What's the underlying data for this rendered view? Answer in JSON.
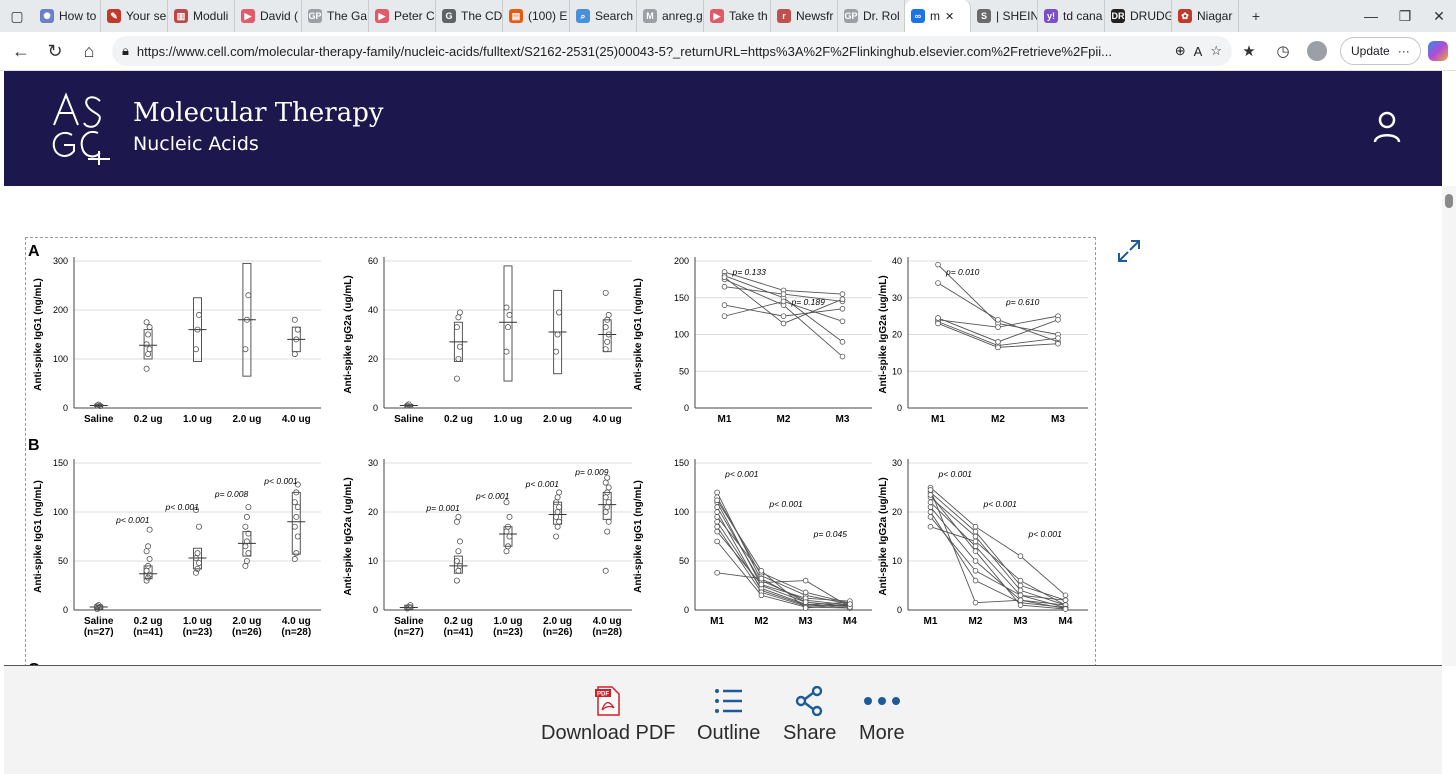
{
  "browser": {
    "tabs": [
      {
        "label": "How to",
        "color": "#6b7fc7",
        "glyph": "✺"
      },
      {
        "label": "Your se",
        "color": "#c0392b",
        "glyph": "✎"
      },
      {
        "label": "Moduli",
        "color": "#b94a4a",
        "glyph": "▥"
      },
      {
        "label": "David (",
        "color": "#e05a6a",
        "glyph": "▶"
      },
      {
        "label": "The Ga",
        "color": "#9aa0a6",
        "glyph": "GP"
      },
      {
        "label": "Peter C",
        "color": "#e05a6a",
        "glyph": "▶"
      },
      {
        "label": "The CD",
        "color": "#5f6368",
        "glyph": "G"
      },
      {
        "label": "(100) E",
        "color": "#e8590c",
        "glyph": "▤"
      },
      {
        "label": "Search",
        "color": "#4a90d9",
        "glyph": "⌕"
      },
      {
        "label": "anreg.g",
        "color": "#9aa0a6",
        "glyph": "M"
      },
      {
        "label": "Take th",
        "color": "#e05a6a",
        "glyph": "▶"
      },
      {
        "label": "Newsfr",
        "color": "#c0504d",
        "glyph": "r"
      },
      {
        "label": "Dr. Rol",
        "color": "#9aa0a6",
        "glyph": "GP"
      },
      {
        "label": "m",
        "color": "#1a73e8",
        "glyph": "∞",
        "active": true
      },
      {
        "label": "| SHEIN",
        "color": "#6a6a6a",
        "glyph": "S"
      },
      {
        "label": "td cana",
        "color": "#7b4fc9",
        "glyph": "y!"
      },
      {
        "label": "DRUDG",
        "color": "#222222",
        "glyph": "DR"
      },
      {
        "label": "Niagar",
        "color": "#c0392b",
        "glyph": "✿"
      }
    ],
    "url": "https://www.cell.com/molecular-therapy-family/nucleic-acids/fulltext/S2162-2531(25)00043-5?_returnURL=https%3A%2F%2Flinkinghub.elsevier.com%2Fretrieve%2Fpii...",
    "update_label": "Update"
  },
  "header": {
    "logo_text": "ASGCT",
    "title": "Molecular Therapy",
    "subtitle": "Nucleic Acids"
  },
  "figure": {
    "panel_labels": [
      "A",
      "B",
      "C"
    ],
    "ylabels": [
      "Anti-spike IgG1 (ng/mL)",
      "Anti-spike IgG2a (ug/mL)",
      "Anti-spike IgG1 (ng/mL)",
      "Anti-spike IgG2a (ug/mL)"
    ],
    "dose_categories": [
      "Saline",
      "0.2 ug",
      "1.0 ug",
      "2.0 ug",
      "4.0 ug"
    ],
    "dose_n": [
      "(n=27)",
      "(n=41)",
      "(n=23)",
      "(n=26)",
      "(n=28)"
    ],
    "months_a": [
      "M1",
      "M2",
      "M3"
    ],
    "months_b": [
      "M1",
      "M2",
      "M3",
      "M4"
    ],
    "yticks": {
      "a1": [
        "0",
        "100",
        "200",
        "300"
      ],
      "a2": [
        "0",
        "20",
        "40",
        "60"
      ],
      "a3": [
        "0",
        "50",
        "100",
        "150",
        "200"
      ],
      "a4": [
        "0",
        "10",
        "20",
        "30",
        "40"
      ],
      "b1": [
        "0",
        "50",
        "100",
        "150"
      ],
      "b2": [
        "0",
        "10",
        "20",
        "30"
      ],
      "b3": [
        "0",
        "50",
        "100",
        "150"
      ],
      "b4": [
        "0",
        "10",
        "20",
        "30"
      ]
    },
    "pvalues": {
      "a3": [
        "p= 0.133",
        "p= 0.189"
      ],
      "a4": [
        "p= 0.010",
        "p= 0.610"
      ],
      "b1": [
        "p< 0.001",
        "p< 0.001",
        "p= 0.008",
        "p< 0.001"
      ],
      "b2": [
        "p= 0.001",
        "p< 0.001",
        "p< 0.001",
        "p= 0.009"
      ],
      "b3": [
        "p< 0.001",
        "p< 0.001",
        "p= 0.045"
      ],
      "b4": [
        "p< 0.001",
        "p< 0.001",
        "p< 0.001"
      ]
    }
  },
  "chart_data": [
    {
      "type": "box",
      "panel": "A",
      "ylabel": "Anti-spike IgG1 (ng/mL)",
      "categories": [
        "Saline",
        "0.2 ug",
        "1.0 ug",
        "2.0 ug",
        "4.0 ug"
      ],
      "ylim": [
        0,
        300
      ],
      "medians": [
        5,
        128,
        160,
        180,
        140
      ],
      "boxes": [
        [
          3,
          7
        ],
        [
          100,
          160
        ],
        [
          95,
          225
        ],
        [
          65,
          295
        ],
        [
          115,
          165
        ]
      ],
      "points": [
        [
          5,
          7,
          4
        ],
        [
          80,
          110,
          120,
          130,
          150,
          165,
          175
        ],
        [
          120,
          160,
          190
        ],
        [
          120,
          180,
          230
        ],
        [
          110,
          140,
          160,
          180
        ]
      ]
    },
    {
      "type": "box",
      "panel": "A",
      "ylabel": "Anti-spike IgG2a (ug/mL)",
      "categories": [
        "Saline",
        "0.2 ug",
        "1.0 ug",
        "2.0 ug",
        "4.0 ug"
      ],
      "ylim": [
        0,
        60
      ],
      "medians": [
        1,
        27,
        35,
        31,
        30
      ],
      "boxes": [
        [
          0.5,
          1.5
        ],
        [
          19,
          35
        ],
        [
          11,
          58
        ],
        [
          14,
          48
        ],
        [
          23,
          36
        ]
      ],
      "points": [
        [
          1,
          1.5
        ],
        [
          12,
          20,
          25,
          33,
          37,
          39
        ],
        [
          23,
          33,
          38,
          41
        ],
        [
          23,
          30,
          39
        ],
        [
          24,
          27,
          30,
          33,
          36,
          38,
          47
        ]
      ]
    },
    {
      "type": "line",
      "panel": "A",
      "ylabel": "Anti-spike IgG1 (ng/mL)",
      "x": [
        "M1",
        "M2",
        "M3"
      ],
      "ylim": [
        0,
        200
      ],
      "series": [
        {
          "values": [
            185,
            160,
            155
          ]
        },
        {
          "values": [
            180,
            150,
            90
          ]
        },
        {
          "values": [
            175,
            140,
            70
          ]
        },
        {
          "values": [
            165,
            155,
            145
          ]
        },
        {
          "values": [
            140,
            125,
            135
          ]
        },
        {
          "values": [
            125,
            145,
            118
          ]
        },
        {
          "values": [
            178,
            115,
            148
          ]
        }
      ]
    },
    {
      "type": "line",
      "panel": "A",
      "ylabel": "Anti-spike IgG2a (ug/mL)",
      "x": [
        "M1",
        "M2",
        "M3"
      ],
      "ylim": [
        0,
        40
      ],
      "series": [
        {
          "values": [
            39,
            23,
            20
          ]
        },
        {
          "values": [
            34,
            24,
            18
          ]
        },
        {
          "values": [
            24,
            22,
            25
          ]
        },
        {
          "values": [
            23.5,
            17,
            19
          ]
        },
        {
          "values": [
            23,
            16.5,
            17.5
          ]
        },
        {
          "values": [
            24.5,
            18,
            24
          ]
        }
      ]
    },
    {
      "type": "box",
      "panel": "B",
      "ylabel": "Anti-spike IgG1 (ng/mL)",
      "categories": [
        "Saline",
        "0.2 ug",
        "1.0 ug",
        "2.0 ug",
        "4.0 ug"
      ],
      "ylim": [
        0,
        150
      ],
      "medians": [
        3,
        37,
        53,
        68,
        90
      ],
      "boxes": [
        [
          1,
          5
        ],
        [
          32,
          45
        ],
        [
          42,
          63
        ],
        [
          55,
          80
        ],
        [
          57,
          120
        ]
      ],
      "points": [
        [
          1,
          2,
          3,
          4,
          5
        ],
        [
          30,
          33,
          36,
          40,
          45,
          52,
          60,
          65,
          82
        ],
        [
          38,
          42,
          48,
          53,
          58,
          85,
          102
        ],
        [
          45,
          50,
          58,
          65,
          70,
          78,
          85,
          95,
          105
        ],
        [
          52,
          58,
          75,
          85,
          95,
          105,
          110,
          120,
          128
        ]
      ]
    },
    {
      "type": "box",
      "panel": "B",
      "ylabel": "Anti-spike IgG2a (ug/mL)",
      "categories": [
        "Saline",
        "0.2 ug",
        "1.0 ug",
        "2.0 ug",
        "4.0 ug"
      ],
      "ylim": [
        0,
        30
      ],
      "medians": [
        0.5,
        9,
        15.5,
        19.5,
        21.5
      ],
      "boxes": [
        [
          0.2,
          1
        ],
        [
          7.5,
          11
        ],
        [
          13,
          17
        ],
        [
          17.5,
          22
        ],
        [
          18.5,
          24
        ]
      ],
      "points": [
        [
          0.3,
          0.6,
          1
        ],
        [
          6,
          8,
          9,
          10,
          12,
          14,
          18,
          19
        ],
        [
          12,
          13,
          15,
          16,
          17,
          19,
          22
        ],
        [
          15,
          17,
          18,
          19,
          20,
          21,
          22,
          23,
          24
        ],
        [
          8,
          16,
          18,
          20,
          21,
          22,
          23,
          24,
          25,
          26,
          27
        ]
      ]
    },
    {
      "type": "line",
      "panel": "B",
      "ylabel": "Anti-spike IgG1 (ng/mL)",
      "x": [
        "M1",
        "M2",
        "M3",
        "M4"
      ],
      "ylim": [
        0,
        150
      ],
      "series": [
        {
          "values": [
            120,
            30,
            10,
            5
          ]
        },
        {
          "values": [
            115,
            35,
            15,
            6
          ]
        },
        {
          "values": [
            110,
            25,
            8,
            4
          ]
        },
        {
          "values": [
            105,
            28,
            30,
            3
          ]
        },
        {
          "values": [
            100,
            20,
            5,
            8
          ]
        },
        {
          "values": [
            95,
            38,
            18,
            7
          ]
        },
        {
          "values": [
            90,
            22,
            6,
            2
          ]
        },
        {
          "values": [
            85,
            18,
            4,
            5
          ]
        },
        {
          "values": [
            80,
            26,
            12,
            9
          ]
        },
        {
          "values": [
            70,
            15,
            3,
            2
          ]
        },
        {
          "values": [
            38,
            32,
            8,
            3
          ]
        },
        {
          "values": [
            112,
            40,
            2,
            6
          ]
        }
      ]
    },
    {
      "type": "line",
      "panel": "B",
      "ylabel": "Anti-spike IgG2a (ug/mL)",
      "x": [
        "M1",
        "M2",
        "M3",
        "M4"
      ],
      "ylim": [
        0,
        30
      ],
      "series": [
        {
          "values": [
            25,
            17,
            11,
            3
          ]
        },
        {
          "values": [
            24,
            16,
            5,
            2
          ]
        },
        {
          "values": [
            23,
            15,
            4,
            1
          ]
        },
        {
          "values": [
            22,
            13,
            3,
            0.5
          ]
        },
        {
          "values": [
            21,
            10,
            2,
            1
          ]
        },
        {
          "values": [
            20,
            6,
            1.5,
            0.5
          ]
        },
        {
          "values": [
            19,
            8,
            3,
            2
          ]
        },
        {
          "values": [
            17,
            14,
            6,
            1
          ]
        },
        {
          "values": [
            24.5,
            1.5,
            2,
            0.3
          ]
        },
        {
          "values": [
            23.5,
            12,
            1,
            0.2
          ]
        }
      ]
    }
  ],
  "actions": [
    {
      "key": "download",
      "label": "Download PDF"
    },
    {
      "key": "outline",
      "label": "Outline"
    },
    {
      "key": "share",
      "label": "Share"
    },
    {
      "key": "more",
      "label": "More"
    }
  ],
  "colors": {
    "header_bg": "#1c174d",
    "accent": "#1c5b97",
    "pdf_red": "#d21f26"
  }
}
